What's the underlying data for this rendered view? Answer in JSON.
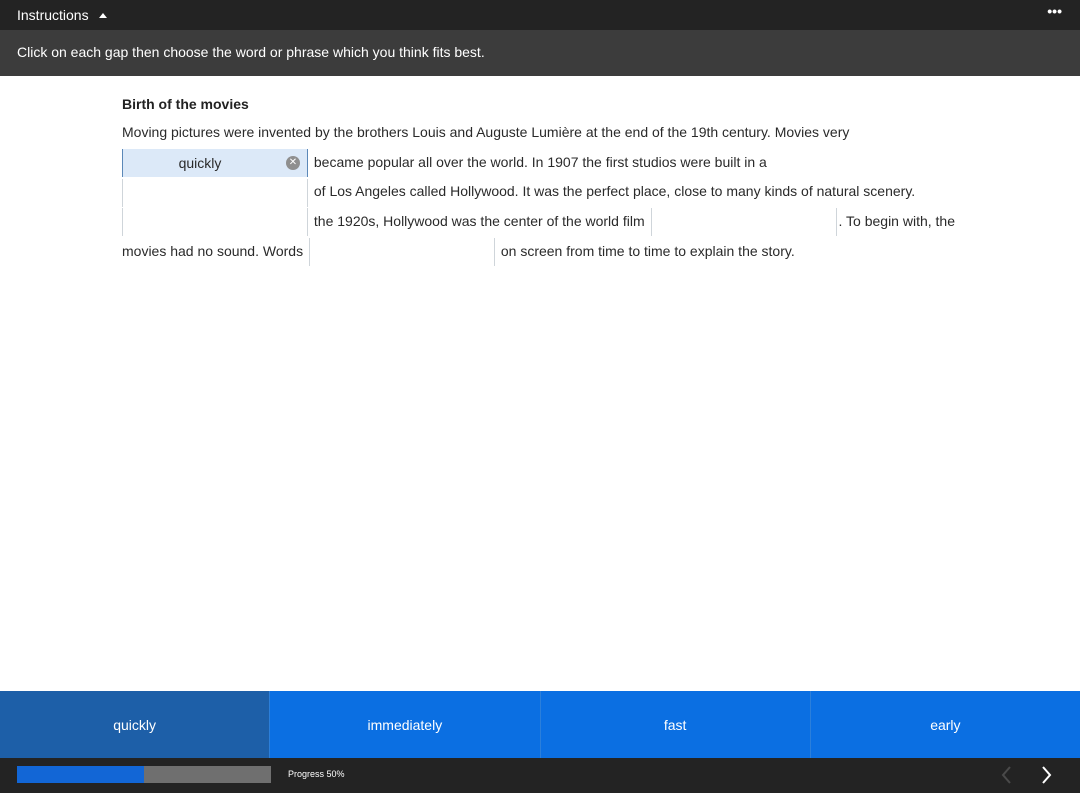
{
  "header": {
    "toggle_label": "Instructions",
    "more_label": "•••",
    "instruction_text": "Click on each gap then choose the word or phrase which you think fits best."
  },
  "passage": {
    "title": "Birth of the movies",
    "seg1": "Moving pictures were invented by the brothers Louis and Auguste Lumière at the end of the 19th century. Movies very",
    "gap1_value": "quickly",
    "seg2": "became popular all over the world. In 1907 the first studios were built in a",
    "seg3": "of Los Angeles called Hollywood. It was the perfect place, close to many kinds of natural scenery.",
    "seg4": "the 1920s, Hollywood was the center of the world film",
    "seg5": ". To begin with, the movies had no sound. Words",
    "seg6": "on screen from time to time to explain the story."
  },
  "options": {
    "opt1": "quickly",
    "opt2": "immediately",
    "opt3": "fast",
    "opt4": "early",
    "selected": "quickly"
  },
  "footer": {
    "progress_label": "Progress 50%",
    "progress_value": 0.5
  },
  "colors": {
    "accent": "#0b6fe2",
    "selected_option": "#1d5fa8",
    "progress_fill": "#1266d6"
  }
}
